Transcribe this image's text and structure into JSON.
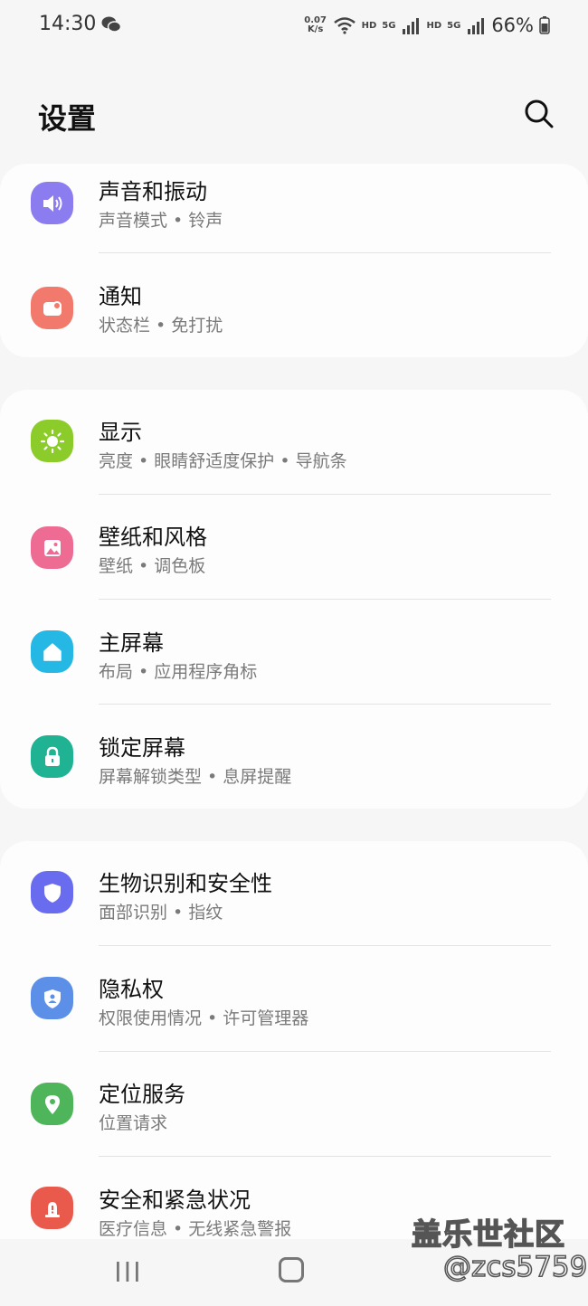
{
  "status_bar": {
    "time": "14:30",
    "net_speed_value": "0.07",
    "net_speed_unit": "K/s",
    "hd1": "HD",
    "hd2": "HD",
    "network1": "5G",
    "network2": "5G",
    "battery": "66%"
  },
  "header": {
    "title": "设置"
  },
  "groups": [
    {
      "items": [
        {
          "title": "声音和振动",
          "subtitle": "声音模式 • 铃声",
          "icon": "volume-icon",
          "color": "#8b7cf0"
        },
        {
          "title": "通知",
          "subtitle": "状态栏 • 免打扰",
          "icon": "notification-icon",
          "color": "#f27a6c"
        }
      ]
    },
    {
      "items": [
        {
          "title": "显示",
          "subtitle": "亮度 • 眼睛舒适度保护 • 导航条",
          "icon": "brightness-icon",
          "color": "#8ccc2a"
        },
        {
          "title": "壁纸和风格",
          "subtitle": "壁纸 • 调色板",
          "icon": "wallpaper-icon",
          "color": "#ee6b94"
        },
        {
          "title": "主屏幕",
          "subtitle": "布局 • 应用程序角标",
          "icon": "home-icon",
          "color": "#25b8e4"
        },
        {
          "title": "锁定屏幕",
          "subtitle": "屏幕解锁类型 • 息屏提醒",
          "icon": "lock-icon",
          "color": "#1fb394"
        }
      ]
    },
    {
      "items": [
        {
          "title": "生物识别和安全性",
          "subtitle": "面部识别 • 指纹",
          "icon": "shield-icon",
          "color": "#6a6cf0"
        },
        {
          "title": "隐私权",
          "subtitle": "权限使用情况 • 许可管理器",
          "icon": "privacy-shield-icon",
          "color": "#5b8fe8"
        },
        {
          "title": "定位服务",
          "subtitle": "位置请求",
          "icon": "location-pin-icon",
          "color": "#4fb55a"
        },
        {
          "title": "安全和紧急状况",
          "subtitle": "医疗信息 • 无线紧急警报",
          "icon": "emergency-icon",
          "color": "#ea5a4c"
        }
      ]
    }
  ],
  "watermark": {
    "line1": "盖乐世社区",
    "line2": "@zcs5759"
  }
}
